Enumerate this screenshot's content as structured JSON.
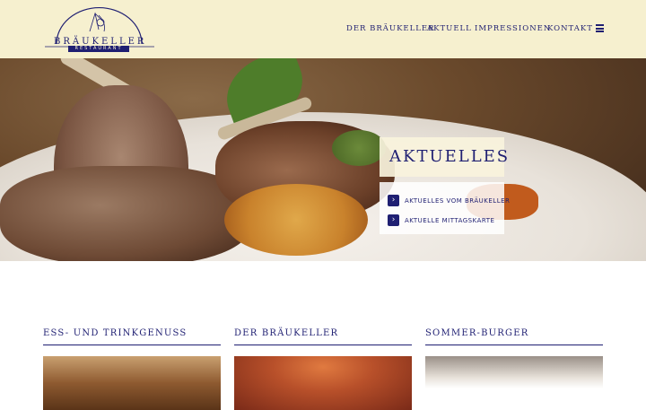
{
  "logo": {
    "name": "BRÄUKELLER",
    "sub": "RESTAURANT"
  },
  "nav": {
    "items": [
      "DER BRÄUKELLER",
      "AKTUELL",
      "IMPRESSIONEN",
      "KONTAKT"
    ],
    "menu_icon": "hamburger-icon"
  },
  "hero": {
    "title": "AKTUELLES",
    "links": [
      "AKTUELLES VOM BRÄUKELLER",
      "AKTUELLE MITTAGSKARTE"
    ]
  },
  "columns": [
    {
      "title": "ESS- UND TRINKGENUSS"
    },
    {
      "title": "DER BRÄUKELLER"
    },
    {
      "title": "SOMMER-BURGER"
    }
  ],
  "colors": {
    "brand_navy": "#1f1f72",
    "header_bg": "#f6f0cf"
  }
}
